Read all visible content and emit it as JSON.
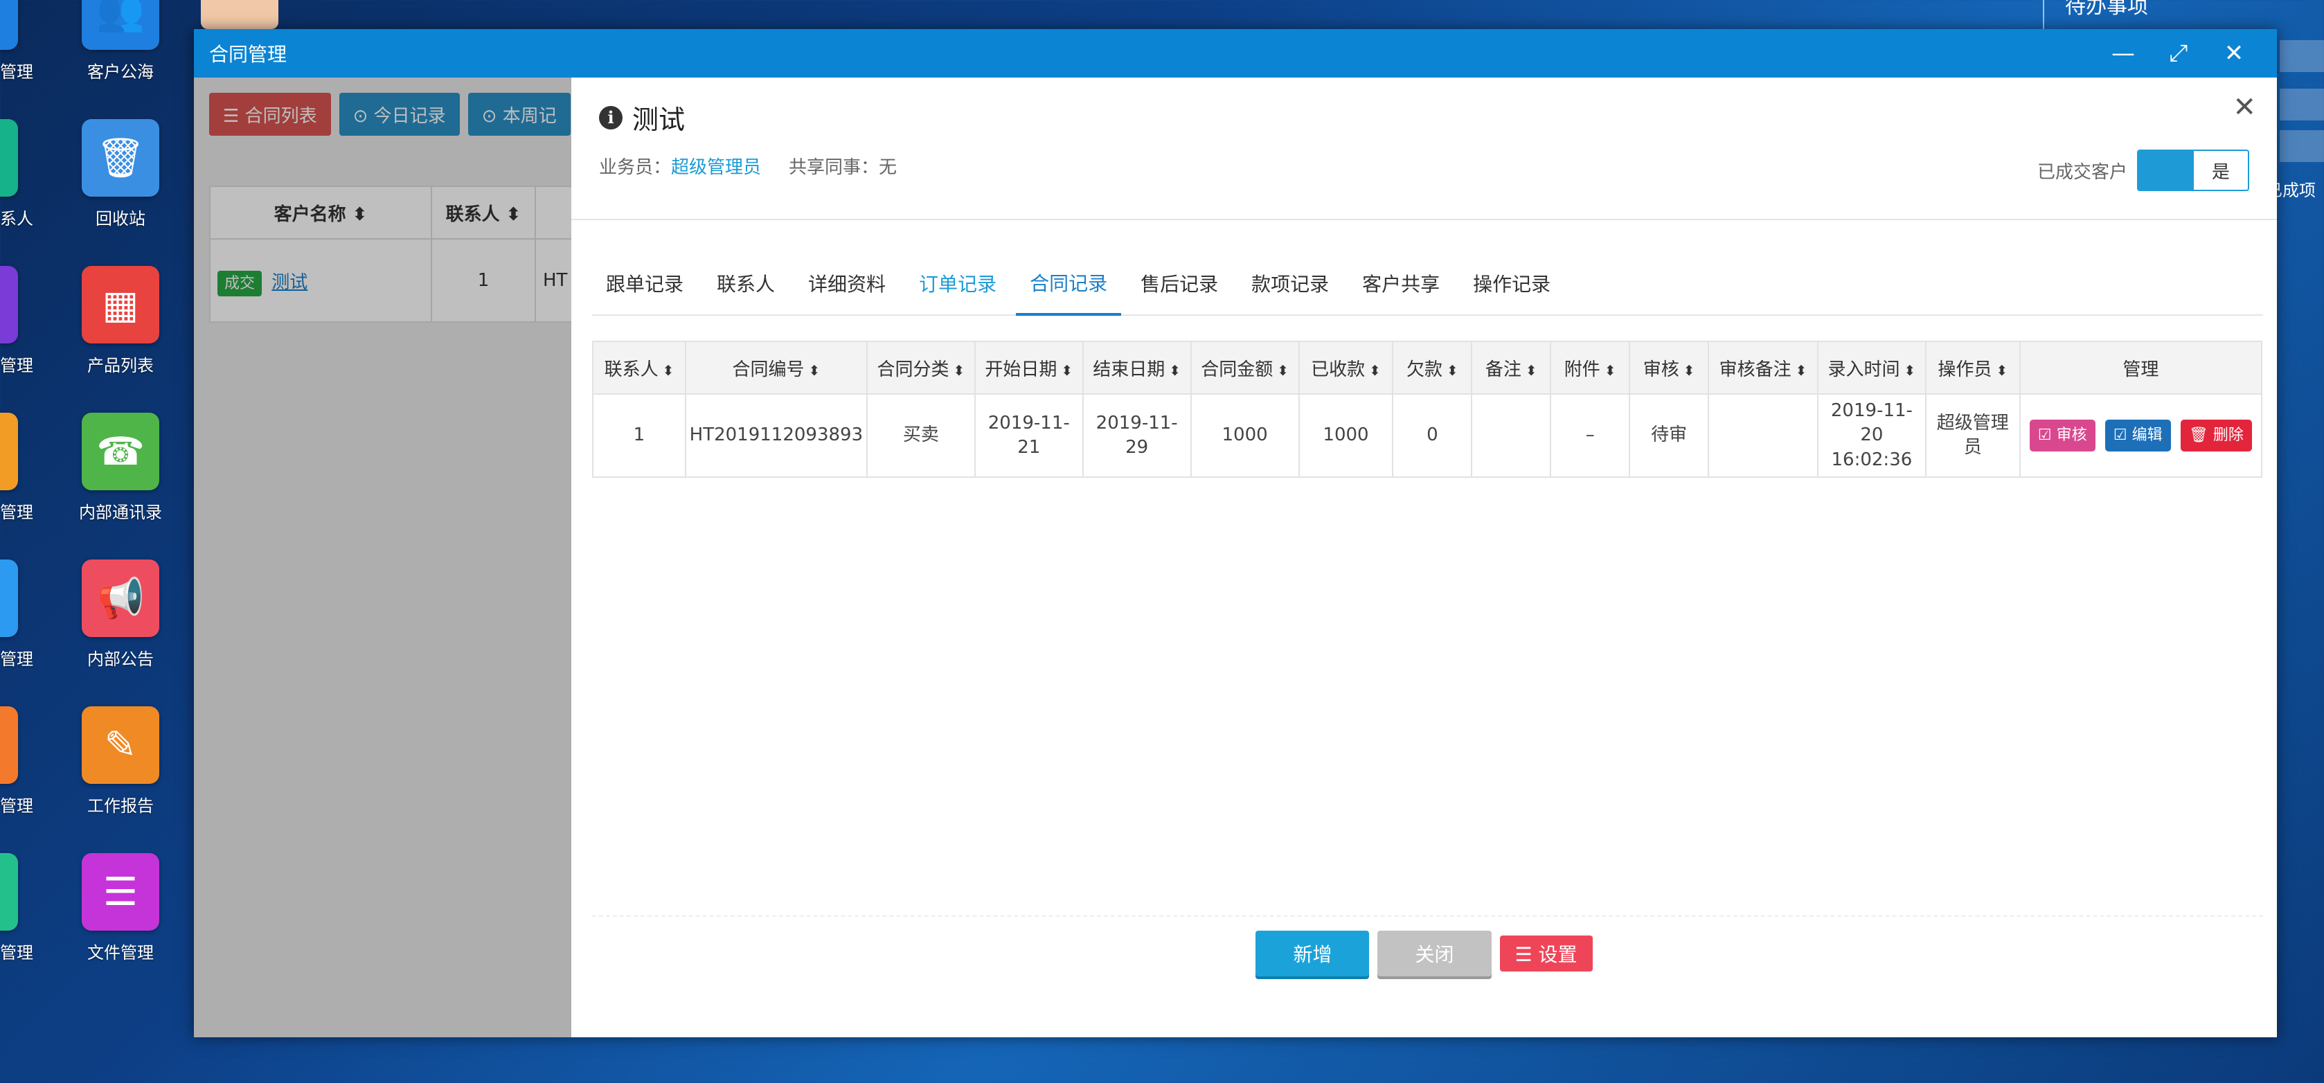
{
  "desktop": {
    "left_labels": [
      "管理",
      "系人",
      "管理",
      "管理",
      "管理",
      "管理",
      "管理"
    ],
    "icons": [
      {
        "label": "客户公海",
        "color": "#1e7fe0",
        "glyph": "👥"
      },
      {
        "label": "回收站",
        "color": "#3b8fe3",
        "glyph": "🗑"
      },
      {
        "label": "产品列表",
        "color": "#e8433e",
        "glyph": "▦"
      },
      {
        "label": "内部通讯录",
        "color": "#4fb548",
        "glyph": "☎"
      },
      {
        "label": "内部公告",
        "color": "#ee4d60",
        "glyph": "📢"
      },
      {
        "label": "工作报告",
        "color": "#f08a25",
        "glyph": "✎"
      },
      {
        "label": "文件管理",
        "color": "#c534d8",
        "glyph": "☰"
      }
    ],
    "right_panel": {
      "todo": "待办事项",
      "done": "已成项"
    }
  },
  "window": {
    "title": "合同管理",
    "minimize": "—",
    "maximize": "⤢",
    "close": "✕"
  },
  "background_list": {
    "buttons": [
      {
        "label": "☰ 合同列表",
        "color": "#d9534f"
      },
      {
        "label": "⊙ 今日记录",
        "color": "#2a8fc5"
      },
      {
        "label": "⊙ 本周记",
        "color": "#2a8fc5"
      }
    ],
    "headers": [
      "客户名称 ⬍",
      "联系人 ⬍",
      ""
    ],
    "row": {
      "badge": "成交",
      "name": "测试",
      "contact": "1",
      "code": "HT"
    }
  },
  "drawer": {
    "close": "✕",
    "title": "测试",
    "salesman_label": "业务员：",
    "salesman": "超级管理员",
    "shared_label": "共享同事：无",
    "deal_label": "已成交客户",
    "deal_value": "是",
    "tabs": [
      {
        "label": "跟单记录",
        "state": "normal"
      },
      {
        "label": "联系人",
        "state": "normal"
      },
      {
        "label": "详细资料",
        "state": "normal"
      },
      {
        "label": "订单记录",
        "state": "link"
      },
      {
        "label": "合同记录",
        "state": "active"
      },
      {
        "label": "售后记录",
        "state": "normal"
      },
      {
        "label": "款项记录",
        "state": "normal"
      },
      {
        "label": "客户共享",
        "state": "normal"
      },
      {
        "label": "操作记录",
        "state": "normal"
      }
    ],
    "table": {
      "headers": [
        "联系人",
        "合同编号",
        "合同分类",
        "开始日期",
        "结束日期",
        "合同金额",
        "已收款",
        "欠款",
        "备注",
        "附件",
        "审核",
        "审核备注",
        "录入时间",
        "操作员",
        "管理"
      ],
      "rows": [
        {
          "cells": [
            "1",
            "HT2019112093893",
            "买卖",
            "2019-11-\n21",
            "2019-11-\n29",
            "1000",
            "1000",
            "0",
            "",
            "–",
            "待审",
            "",
            "2019-11-\n20\n16:02:36",
            "超级管理\n员"
          ],
          "actions": [
            {
              "label": "☑ 审核",
              "color": "#d9488f"
            },
            {
              "label": "☑ 编辑",
              "color": "#1d6fb8"
            },
            {
              "label": "🗑 删除",
              "color": "#e3253c"
            }
          ]
        }
      ]
    },
    "footer": {
      "add": "新增",
      "close": "关闭",
      "settings": "☰ 设置"
    }
  }
}
